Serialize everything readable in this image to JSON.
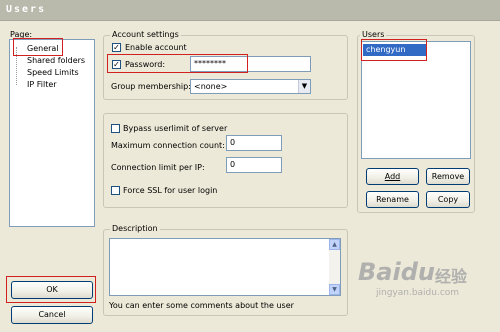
{
  "window": {
    "title": "Users"
  },
  "page_panel": {
    "label": "Page:",
    "items": [
      {
        "label": "General"
      },
      {
        "label": "Shared folders"
      },
      {
        "label": "Speed Limits"
      },
      {
        "label": "IP Filter"
      }
    ]
  },
  "account_settings": {
    "legend": "Account settings",
    "enable_account_label": "Enable account",
    "enable_account_checked": true,
    "password_label": "Password:",
    "password_checked": true,
    "password_value": "********",
    "group_membership_label": "Group membership:",
    "group_membership_value": "<none>"
  },
  "limits": {
    "bypass_label": "Bypass userlimit of server",
    "bypass_checked": false,
    "max_conn_label": "Maximum connection count:",
    "max_conn_value": "0",
    "conn_limit_label": "Connection limit per IP:",
    "conn_limit_value": "0",
    "force_ssl_label": "Force SSL for user login",
    "force_ssl_checked": false
  },
  "description": {
    "legend": "Description",
    "value": "",
    "hint": "You can enter some comments about the user"
  },
  "users": {
    "legend": "Users",
    "items": [
      {
        "label": "chengyun",
        "selected": true
      }
    ],
    "add_label": "Add",
    "remove_label": "Remove",
    "rename_label": "Rename",
    "copy_label": "Copy"
  },
  "buttons": {
    "ok_label": "OK",
    "cancel_label": "Cancel"
  },
  "watermark": {
    "brand": "Baidu",
    "cn": "经验",
    "url": "jingyan.baidu.com"
  },
  "colors": {
    "highlight": "#316ac5",
    "red_box": "#d02020",
    "selection_text": "#ffffff"
  }
}
